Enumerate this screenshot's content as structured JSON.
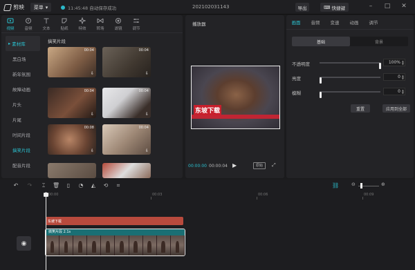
{
  "app": {
    "name": "剪映",
    "menu_label": "菜单",
    "status": "11:45:48 自动保存成功",
    "project": "202102031143"
  },
  "titlebar": {
    "export": "导出",
    "shortcuts": "快捷键"
  },
  "media": {
    "tabs": [
      {
        "label": "视频",
        "icon": "video-icon"
      },
      {
        "label": "音频",
        "icon": "audio-icon"
      },
      {
        "label": "文本",
        "icon": "text-icon"
      },
      {
        "label": "贴纸",
        "icon": "sticker-icon"
      },
      {
        "label": "特效",
        "icon": "effects-icon"
      },
      {
        "label": "转场",
        "icon": "transition-icon"
      },
      {
        "label": "滤镜",
        "icon": "filter-icon"
      },
      {
        "label": "调节",
        "icon": "adjust-icon"
      }
    ],
    "sidebar": [
      "素材库",
      "黑白场",
      "新年氛围",
      "故障动画",
      "片头",
      "片尾",
      "时间片段",
      "搞笑片段",
      "配音片段"
    ],
    "section_heading": "搞笑片段",
    "thumbs": [
      {
        "duration": "00:04"
      },
      {
        "duration": "00:04"
      },
      {
        "duration": "00:04"
      },
      {
        "duration": "00:04"
      },
      {
        "duration": "00:08"
      },
      {
        "duration": "00:04"
      },
      {
        "duration": ""
      },
      {
        "duration": ""
      }
    ]
  },
  "player": {
    "title": "播放器",
    "caption": "东坡下载",
    "time_current": "00:00:00",
    "time_total": "00:00:04",
    "ratio_label": "原始"
  },
  "properties": {
    "tabs": [
      "画面",
      "音频",
      "变速",
      "动画",
      "调节"
    ],
    "segments": [
      "基础",
      "背景"
    ],
    "rows": [
      {
        "label": "不透明度",
        "value": "100%",
        "level": 1.0
      },
      {
        "label": "亮度",
        "value": "0",
        "level": 0.0
      },
      {
        "label": "模糊",
        "value": "0",
        "level": 0.0
      }
    ],
    "reset": "重置",
    "apply_all": "应用到全部"
  },
  "timeline": {
    "ticks": [
      "00:00",
      "00:03",
      "00:06",
      "00:09"
    ],
    "text_clip": "东坡下载",
    "video_clip": "搞笑片段  2.1s"
  },
  "colors": {
    "accent": "#2bc0cf",
    "text_clip": "#b84a3d",
    "caption": "#c81f2c"
  }
}
